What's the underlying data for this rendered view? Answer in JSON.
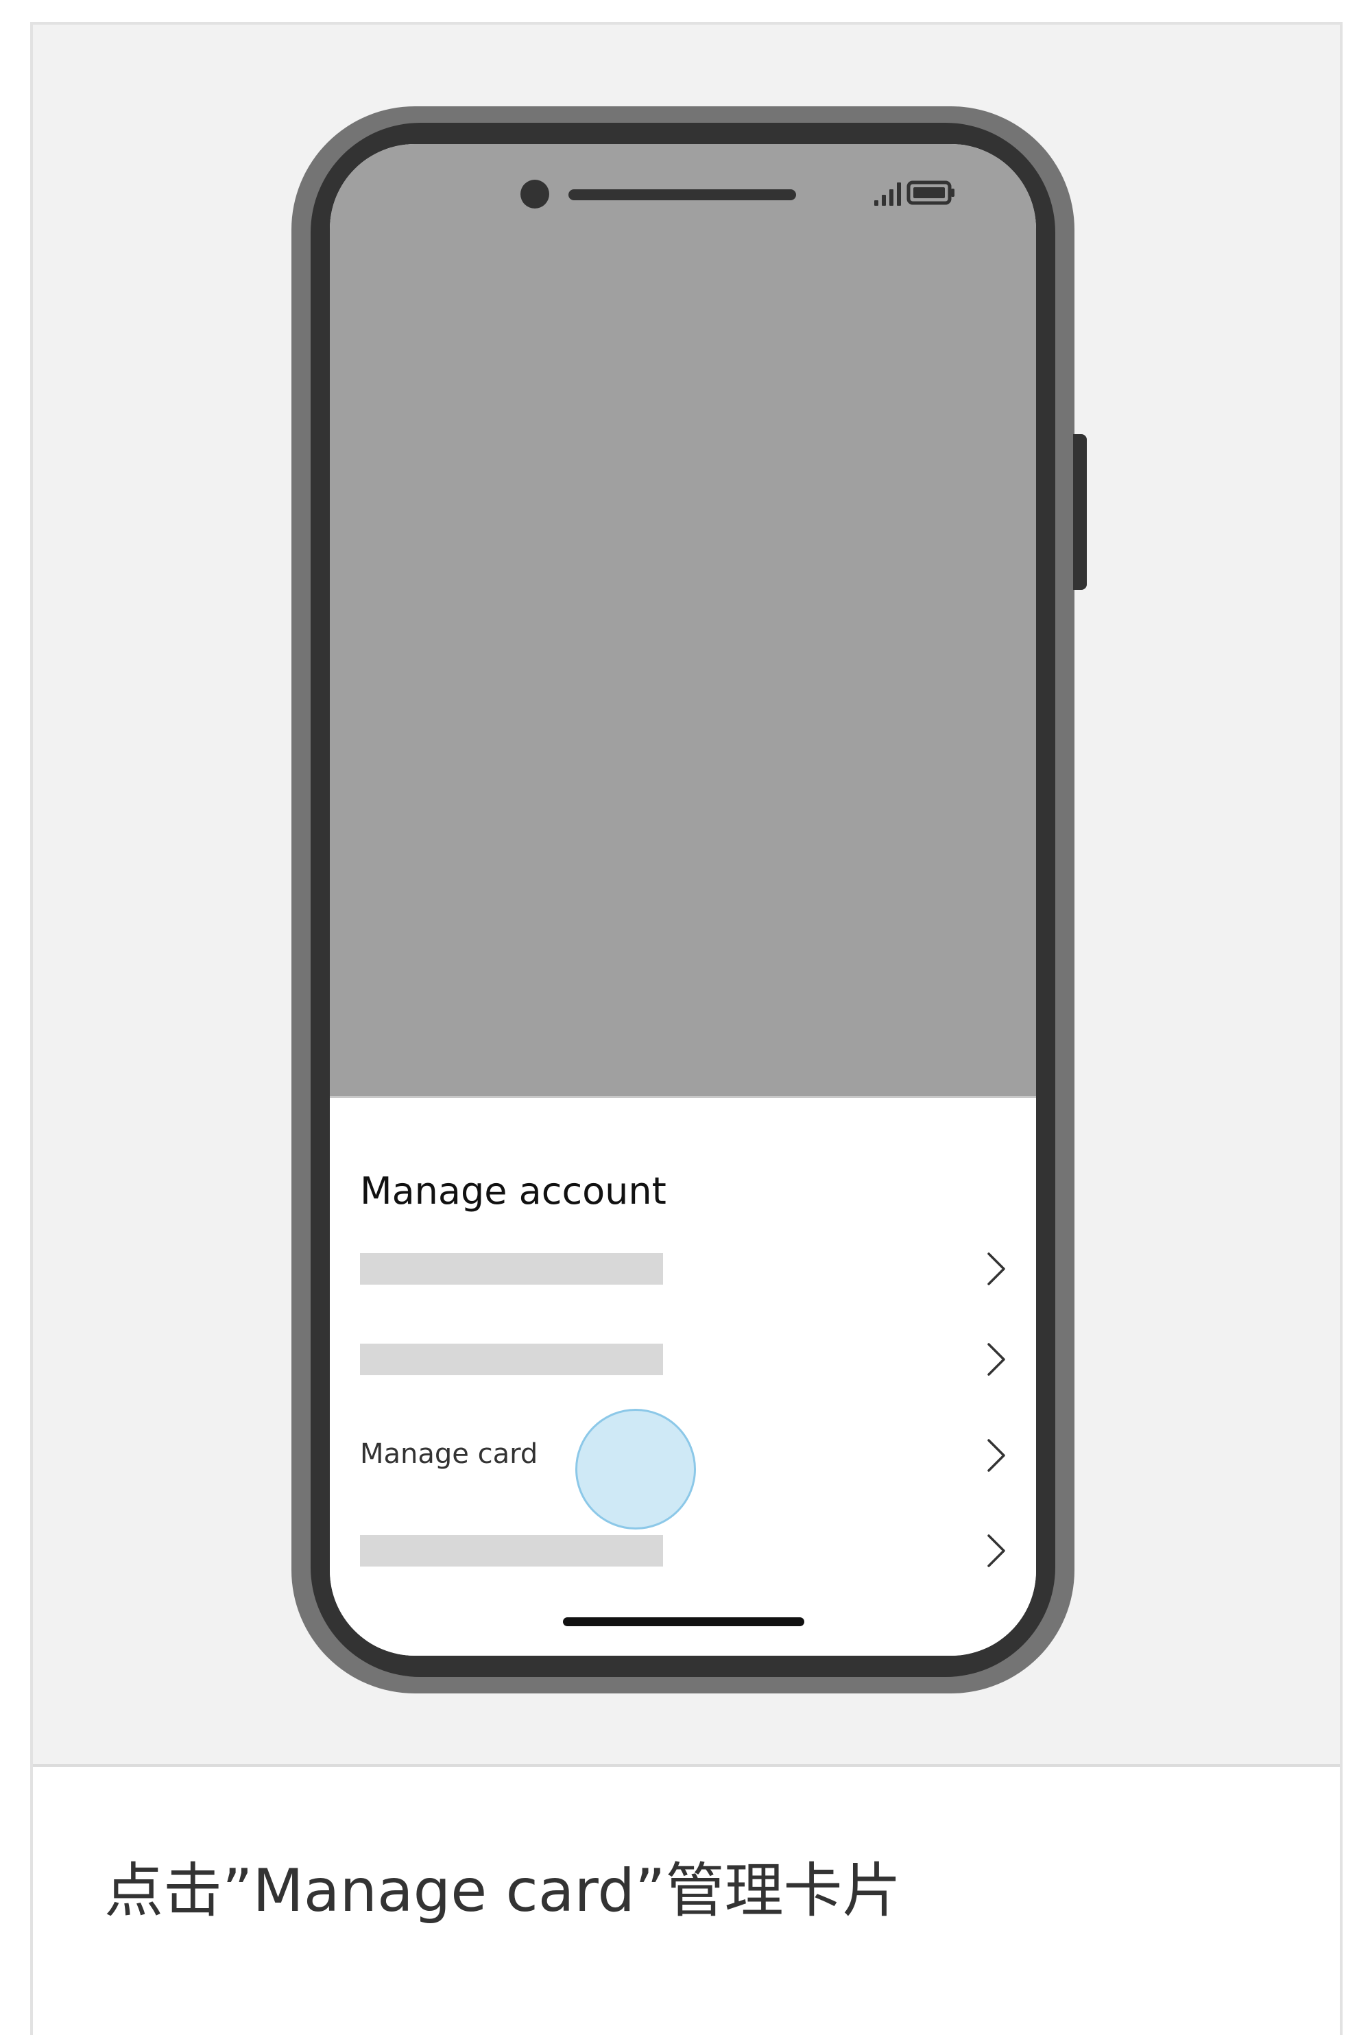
{
  "sheet": {
    "title": "Manage account",
    "rows": [
      {
        "label": "",
        "placeholder": true
      },
      {
        "label": "",
        "placeholder": true
      },
      {
        "label": "Manage card",
        "placeholder": false,
        "tapped": true
      },
      {
        "label": "",
        "placeholder": true
      }
    ]
  },
  "caption": {
    "text": "点击”Manage card”管理卡片"
  },
  "icons": {
    "signal": "signal-bars-icon",
    "battery": "battery-icon",
    "chevron": "chevron-right-icon"
  },
  "colors": {
    "page_background": "#f2f2f2",
    "phone_frame": "#747474",
    "phone_body": "#333333",
    "screen_top": "#a0a0a0",
    "placeholder_bar": "#d8d8d8",
    "tap_indicator": "#cfe9f6",
    "tap_indicator_border": "#8cc8e8"
  }
}
